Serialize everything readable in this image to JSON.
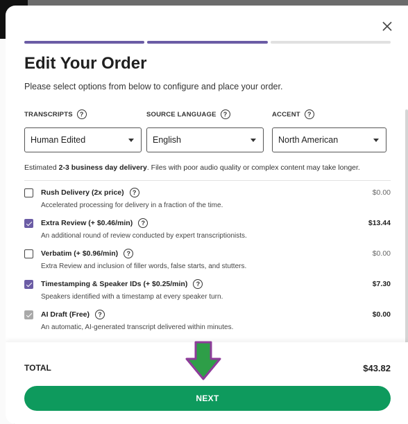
{
  "modal": {
    "title": "Edit Your Order",
    "subtitle": "Please select options from below to configure and place your order.",
    "close_icon": "close-x-icon",
    "progress": {
      "total_steps": 3,
      "completed_steps": 2
    }
  },
  "selects": [
    {
      "label": "TRANSCRIPTS",
      "value": "Human Edited"
    },
    {
      "label": "SOURCE LANGUAGE",
      "value": "English"
    },
    {
      "label": "ACCENT",
      "value": "North American"
    }
  ],
  "help_glyph": "?",
  "estimate": {
    "prefix": "Estimated ",
    "bold": "2-3 business day delivery",
    "suffix": ". Files with poor audio quality or complex content may take longer."
  },
  "options": [
    {
      "title": "Rush Delivery (2x price)",
      "description": "Accelerated processing for delivery in a fraction of the time.",
      "price": "$0.00",
      "checked": false,
      "disabled": false
    },
    {
      "title": "Extra Review (+ $0.46/min)",
      "description": "An additional round of review conducted by expert transcriptionists.",
      "price": "$13.44",
      "checked": true,
      "disabled": false
    },
    {
      "title": "Verbatim (+ $0.96/min)",
      "description": "Extra Review and inclusion of filler words, false starts, and stutters.",
      "price": "$0.00",
      "checked": false,
      "disabled": false
    },
    {
      "title": "Timestamping & Speaker IDs (+ $0.25/min)",
      "description": "Speakers identified with a timestamp at every speaker turn.",
      "price": "$7.30",
      "checked": true,
      "disabled": false
    },
    {
      "title": "AI Draft (Free)",
      "description": "An automatic, AI-generated transcript delivered within minutes.",
      "price": "$0.00",
      "checked": true,
      "disabled": true
    }
  ],
  "footer": {
    "total_label": "TOTAL",
    "total_value": "$43.82",
    "next_label": "NEXT"
  },
  "colors": {
    "accent": "#6b5ca5",
    "primary_button": "#0e9a5d",
    "annotation_arrow_fill": "#2e9e48",
    "annotation_arrow_stroke": "#8e3c9a"
  }
}
